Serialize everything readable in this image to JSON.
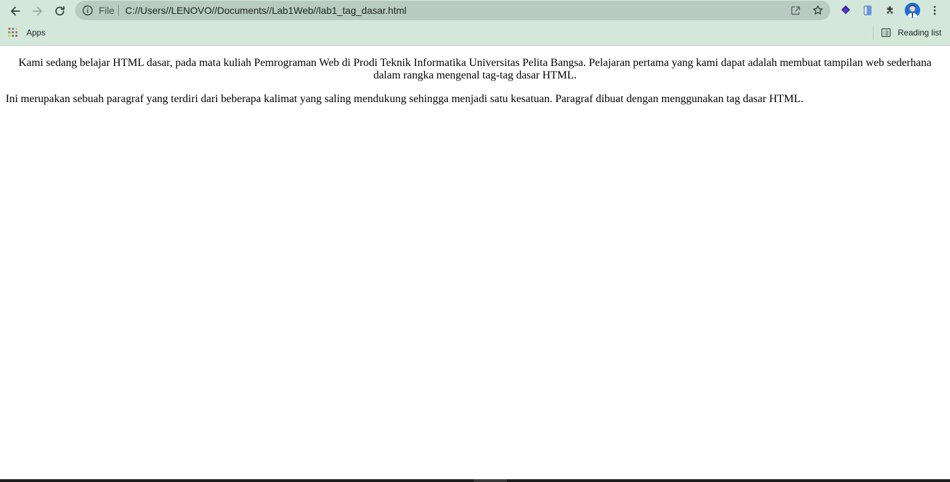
{
  "browser": {
    "nav": {
      "back_icon": "arrow-left-icon",
      "forward_icon": "arrow-right-icon",
      "reload_icon": "reload-icon"
    },
    "omnibox": {
      "scheme_label": "File",
      "url": "C://Users//LENOVO//Documents//Lab1Web//lab1_tag_dasar.html"
    },
    "bookmarks": {
      "apps_label": "Apps",
      "reading_list_label": "Reading list"
    },
    "colors": {
      "toolbar_bg": "#d3e8da",
      "omnibox_bg": "#b8ccc1",
      "accent": "#1f6fd6"
    }
  },
  "page": {
    "paragraph_centered": "Kami sedang belajar HTML dasar, pada mata kuliah Pemrograman Web di Prodi Teknik Informatika Universitas Pelita Bangsa. Pelajaran pertama yang kami dapat adalah membuat tampilan web sederhana dalam rangka mengenal tag-tag dasar HTML.",
    "paragraph_normal": "Ini merupakan sebuah paragraf yang terdiri dari beberapa kalimat yang saling mendukung sehingga menjadi satu kesatuan. Paragraf dibuat dengan menggunakan tag dasar HTML."
  }
}
